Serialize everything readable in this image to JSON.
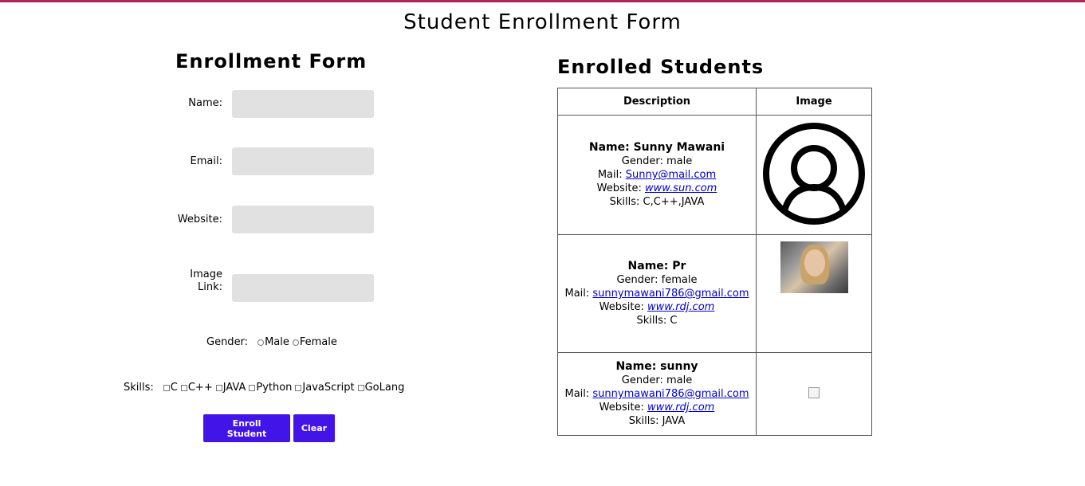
{
  "page_title": "Student Enrollment Form",
  "form": {
    "title": "Enrollment Form",
    "name_label": "Name:",
    "email_label": "Email:",
    "website_label": "Website:",
    "image_label_1": "Image",
    "image_label_2": "Link:",
    "name_value": "",
    "email_value": "",
    "website_value": "",
    "image_value": "",
    "gender_label": "Gender:",
    "gender_options": [
      "Male",
      "Female"
    ],
    "skills_label": "Skills:",
    "skill_options": [
      "C",
      "C++",
      "JAVA",
      "Python",
      "JavaScript",
      "GoLang"
    ],
    "enroll_button": "Enroll Student",
    "clear_button": "Clear",
    "button_color": "#4314e8"
  },
  "students": {
    "title": "Enrolled Students",
    "headers": [
      "Description",
      "Image"
    ],
    "rows": [
      {
        "name_label": "Name: Sunny Mawani",
        "gender_line": "Gender: male",
        "mail_prefix": "Mail: ",
        "mail": "Sunny@mail.com",
        "website_prefix": "Website: ",
        "website": "www.sun.com",
        "skills_line": "Skills: C,C++,JAVA",
        "image": "user-avatar-icon"
      },
      {
        "name_label": "Name: Pr",
        "gender_line": "Gender: female",
        "mail_prefix": "Mail: ",
        "mail": "sunnymawani786@gmail.com",
        "website_prefix": "Website: ",
        "website": "www.rdj.com",
        "skills_line": "Skills: C",
        "image": "photo"
      },
      {
        "name_label": "Name: sunny",
        "gender_line": "Gender: male",
        "mail_prefix": "Mail: ",
        "mail": "sunnymawani786@gmail.com",
        "website_prefix": "Website: ",
        "website": "www.rdj.com",
        "skills_line": "Skills: JAVA",
        "image": "broken-image-icon"
      }
    ]
  },
  "colors": {
    "top_border": "#b0245a",
    "input_bg": "#e1e1e1",
    "link": "#0000cc"
  }
}
